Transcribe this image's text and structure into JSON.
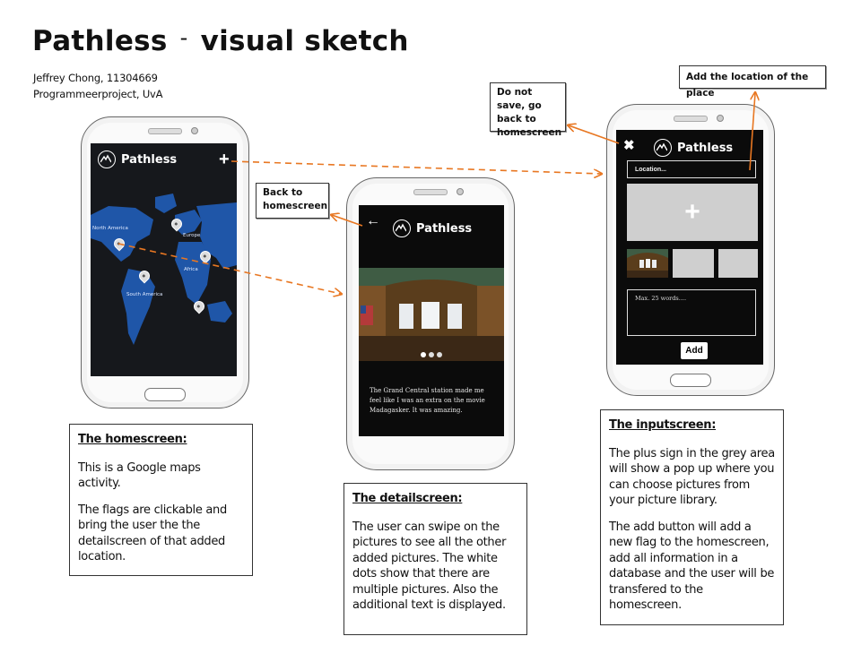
{
  "header": {
    "title": "Pathless",
    "separator": "-",
    "subtitle": "visual sketch",
    "author": "Jeffrey Chong, 11304669",
    "course": "Programmeerproject, UvA"
  },
  "app": {
    "name": "Pathless",
    "accent": "#e87722",
    "map_color": "#1f56a8"
  },
  "homescreen": {
    "plus_glyph": "+",
    "map_labels": [
      "North America",
      "Europe",
      "Africa",
      "South America"
    ]
  },
  "detailscreen": {
    "back_glyph": "←",
    "caption": "The Grand Central station made me feel like I was an extra on the movie Madagasker. It was amazing."
  },
  "inputscreen": {
    "close_glyph": "✖",
    "location_placeholder": "Location...",
    "plus_glyph": "+",
    "words_placeholder": "Max. 25 words....",
    "add_label": "Add"
  },
  "callouts": {
    "add_location": "Add the location of the place",
    "do_not_save": "Do not save, go back to homescreen",
    "back_home": "Back to homescreen"
  },
  "notes": {
    "home": {
      "heading": "The homescreen:",
      "p1": "This is a Google maps activity.",
      "p2": "The flags are clickable and bring the user the the detailscreen of that added location."
    },
    "detail": {
      "heading": "The detailscreen:",
      "p1": "The user can swipe on the pictures to see all the other added pictures. The white dots show that there are multiple pictures. Also the additional text is displayed."
    },
    "input": {
      "heading": "The inputscreen:",
      "p1": "The plus  sign in the grey area will show a pop up where you can choose pictures from your picture library.",
      "p2": "The add button will add a new flag to the homescreen, add all information in a database and the user will be transfered to the homescreen."
    }
  }
}
